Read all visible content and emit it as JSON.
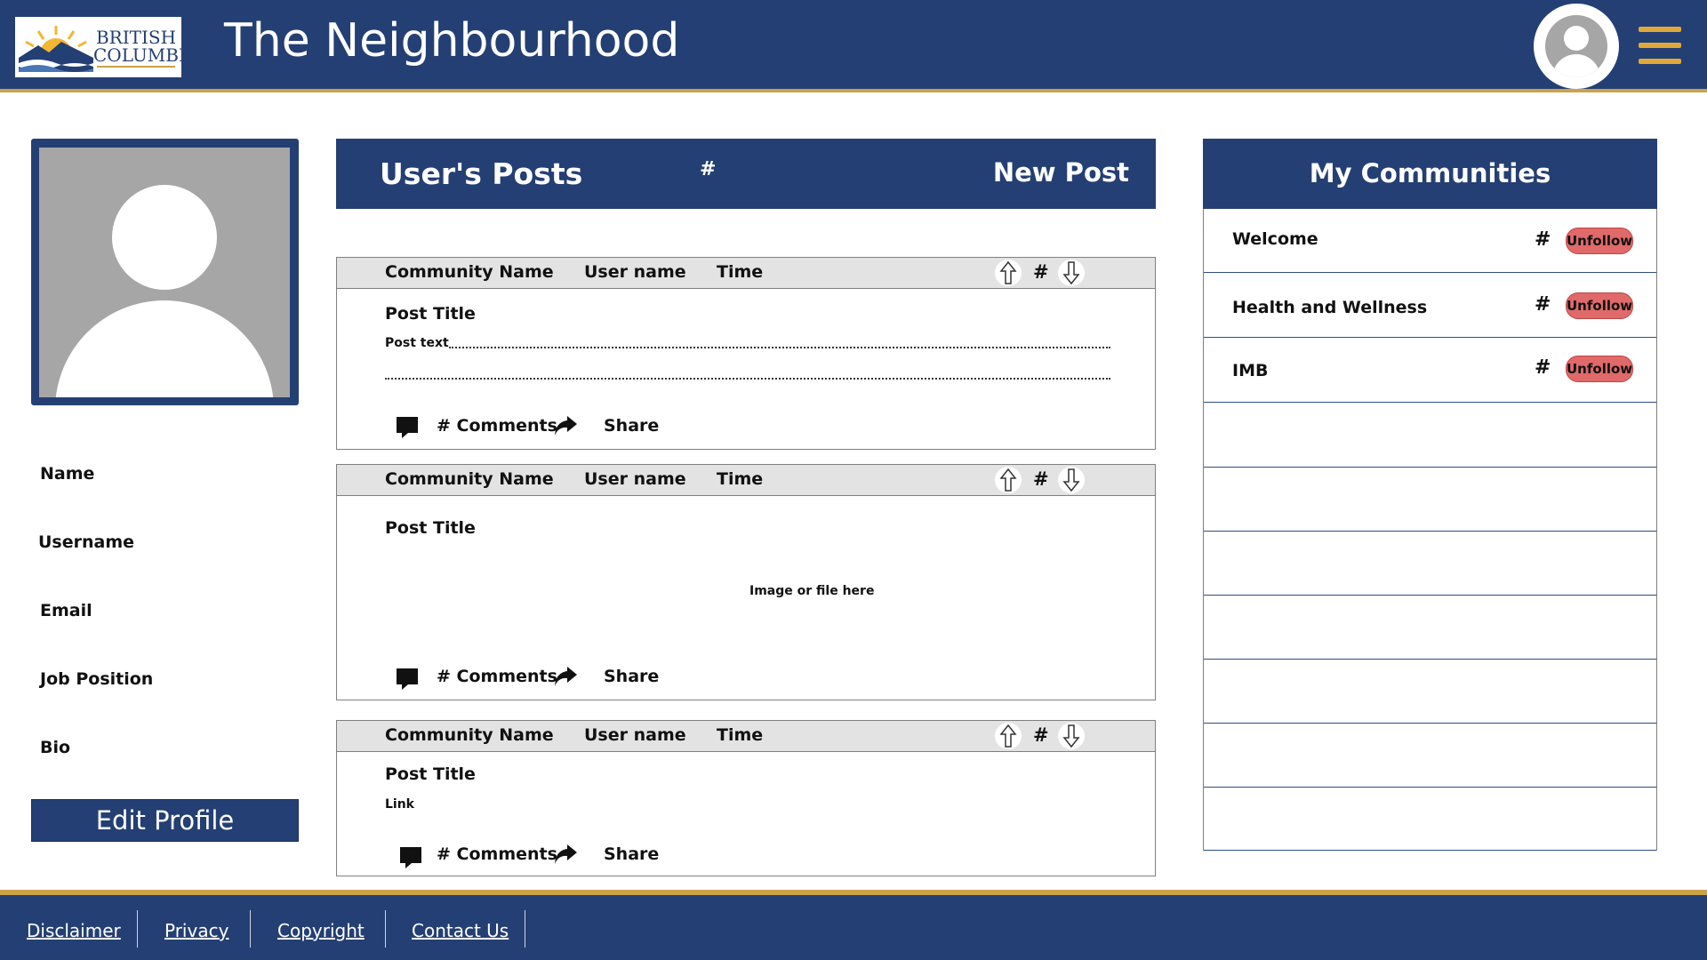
{
  "header": {
    "logo_text_line1": "BRITISH",
    "logo_text_line2": "COLUMBIA",
    "site_title": "The Neighbourhood",
    "icons": [
      "user-avatar-icon",
      "hamburger-menu-icon"
    ],
    "colors": {
      "primary": "#243f73",
      "accent": "#c9a24a",
      "menu": "#e0a83b"
    }
  },
  "profile": {
    "fields": {
      "name": "Name",
      "username": "Username",
      "email": "Email",
      "job_position": "Job Position",
      "bio": "Bio"
    },
    "edit_button": "Edit Profile"
  },
  "posts_panel": {
    "title": "User's Posts",
    "count": "#",
    "new_post": "New Post"
  },
  "posts": [
    {
      "community": "Community Name",
      "user": "User name",
      "time": "Time",
      "votes": "#",
      "title": "Post Title",
      "body": "Post text",
      "comments": "# Comments",
      "share": "Share"
    },
    {
      "community": "Community Name",
      "user": "User name",
      "time": "Time",
      "votes": "#",
      "title": "Post Title",
      "body": "Image or file here",
      "comments": "# Comments",
      "share": "Share"
    },
    {
      "community": "Community Name",
      "user": "User name",
      "time": "Time",
      "votes": "#",
      "title": "Post Title",
      "body": "Link",
      "comments": "# Comments",
      "share": "Share"
    }
  ],
  "communities": {
    "title": "My Communities",
    "items": [
      {
        "name": "Welcome",
        "count": "#",
        "action": "Unfollow"
      },
      {
        "name": "Health and Wellness",
        "count": "#",
        "action": "Unfollow"
      },
      {
        "name": "IMB",
        "count": "#",
        "action": "Unfollow"
      }
    ],
    "unfollow_color": "#e06a6a"
  },
  "footer": {
    "links": [
      "Disclaimer",
      "Privacy",
      "Copyright",
      "Contact Us"
    ]
  }
}
